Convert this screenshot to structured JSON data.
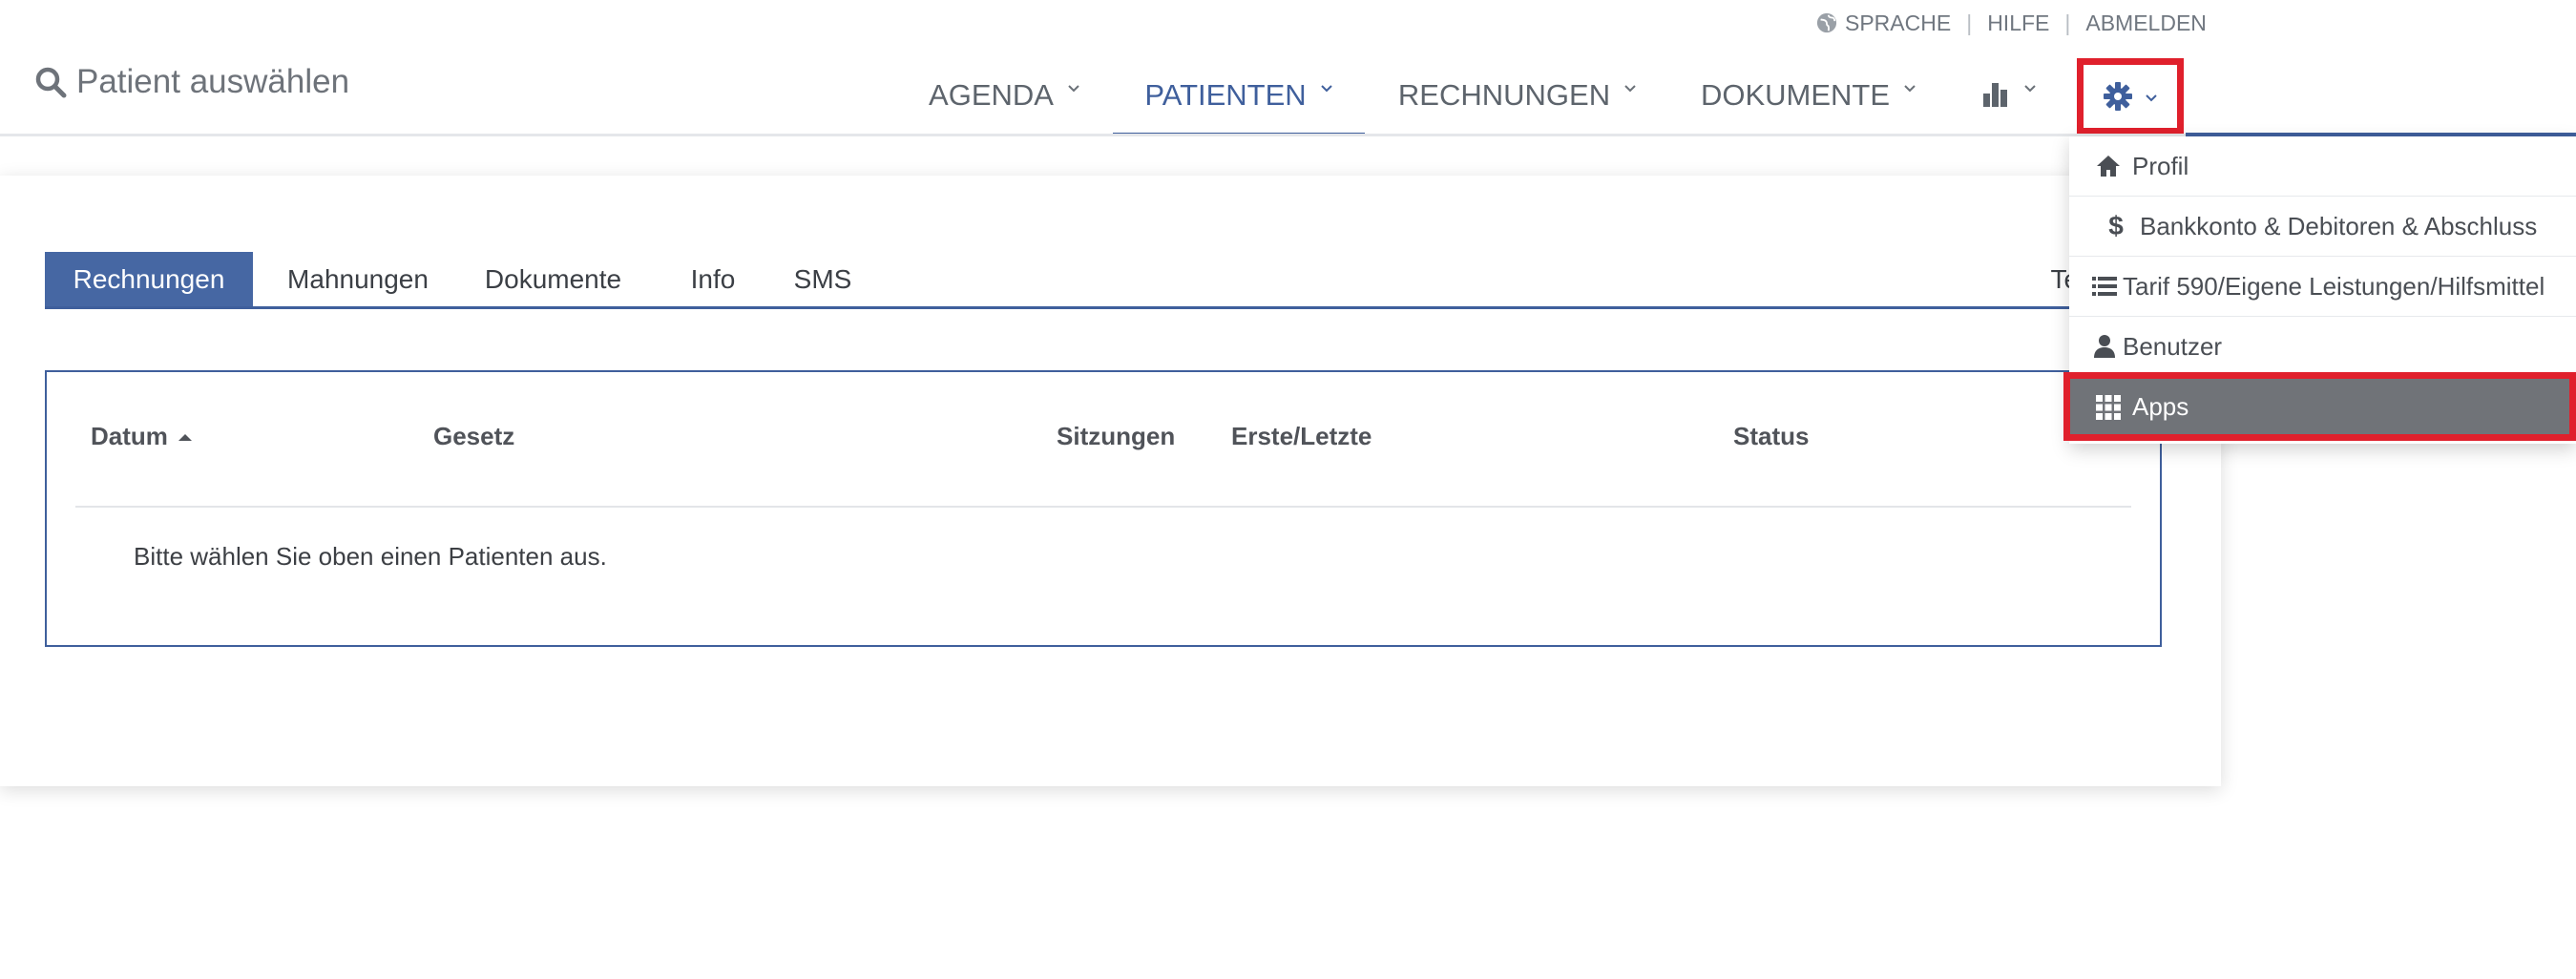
{
  "utility_links": {
    "language": "SPRACHE",
    "help": "HILFE",
    "logout": "ABMELDEN"
  },
  "header": {
    "patient_search": "Patient auswählen"
  },
  "nav": {
    "items": [
      {
        "label": "AGENDA"
      },
      {
        "label": "PATIENTEN"
      },
      {
        "label": "RECHNUNGEN"
      },
      {
        "label": "DOKUMENTE"
      }
    ],
    "stats_icon": "bar-chart-icon",
    "settings_icon": "gear-icon"
  },
  "tabs": {
    "items": [
      {
        "label": "Rechnungen"
      },
      {
        "label": "Mahnungen"
      },
      {
        "label": "Dokumente"
      },
      {
        "label": "Info"
      },
      {
        "label": "SMS"
      }
    ],
    "truncated_right": "Ter"
  },
  "table": {
    "columns": [
      "Datum",
      "Gesetz",
      "Sitzungen",
      "Erste/Letzte",
      "Status"
    ],
    "empty_message": "Bitte wählen Sie oben einen Patienten aus."
  },
  "settings_menu": {
    "items": [
      {
        "label": "Profil",
        "icon": "home-icon"
      },
      {
        "label": "Bankkonto & Debitoren & Abschluss",
        "icon": "dollar-icon"
      },
      {
        "label": "Tarif 590/Eigene Leistungen/Hilfsmittel",
        "icon": "list-icon"
      },
      {
        "label": "Benutzer",
        "icon": "user-icon"
      },
      {
        "label": "Apps",
        "icon": "grid-icon"
      }
    ]
  },
  "colors": {
    "primary": "#3f5f9c",
    "tab_active": "#4667a3",
    "highlight": "#e0202c",
    "menu_active": "#707378"
  }
}
